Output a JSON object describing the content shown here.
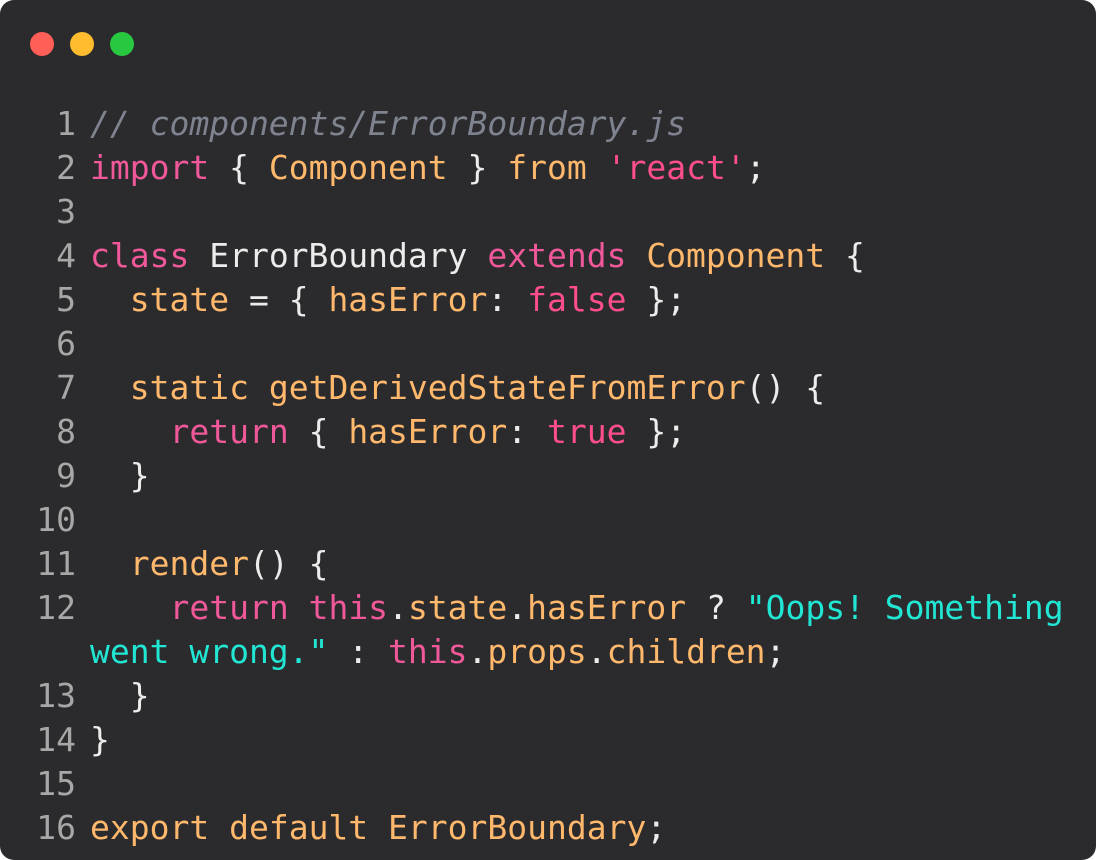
{
  "window": {
    "controls": [
      {
        "name": "close",
        "color": "#ff5f57"
      },
      {
        "name": "minimize",
        "color": "#febc2e"
      },
      {
        "name": "zoom",
        "color": "#28c840"
      }
    ]
  },
  "colors": {
    "background": "#2b2b2d",
    "keyword": "#f0589a",
    "identifier": "#ffb86c",
    "string": "#22e6d4",
    "comment": "#7f8390",
    "line_number": "#a7a7a7"
  },
  "code": {
    "lines": [
      {
        "n": "1",
        "tokens": [
          {
            "t": "// components/ErrorBoundary.js",
            "c": "comment"
          }
        ]
      },
      {
        "n": "2",
        "tokens": [
          {
            "t": "import",
            "c": "key"
          },
          {
            "t": " { ",
            "c": "plain"
          },
          {
            "t": "Component",
            "c": "orange"
          },
          {
            "t": " } ",
            "c": "plain"
          },
          {
            "t": "from",
            "c": "orange"
          },
          {
            "t": " ",
            "c": "plain"
          },
          {
            "t": "'react'",
            "c": "string"
          },
          {
            "t": ";",
            "c": "plain"
          }
        ]
      },
      {
        "n": "3",
        "tokens": []
      },
      {
        "n": "4",
        "tokens": [
          {
            "t": "class",
            "c": "key"
          },
          {
            "t": " ErrorBoundary ",
            "c": "plain"
          },
          {
            "t": "extends",
            "c": "key"
          },
          {
            "t": " ",
            "c": "plain"
          },
          {
            "t": "Component",
            "c": "orange"
          },
          {
            "t": " {",
            "c": "plain"
          }
        ]
      },
      {
        "n": "5",
        "tokens": [
          {
            "t": "  ",
            "c": "plain"
          },
          {
            "t": "state",
            "c": "orange"
          },
          {
            "t": " = { ",
            "c": "plain"
          },
          {
            "t": "hasError",
            "c": "orange"
          },
          {
            "t": ": ",
            "c": "plain"
          },
          {
            "t": "false",
            "c": "bool"
          },
          {
            "t": " };",
            "c": "plain"
          }
        ]
      },
      {
        "n": "6",
        "tokens": []
      },
      {
        "n": "7",
        "tokens": [
          {
            "t": "  ",
            "c": "plain"
          },
          {
            "t": "static",
            "c": "orange"
          },
          {
            "t": " ",
            "c": "plain"
          },
          {
            "t": "getDerivedStateFromError",
            "c": "orange"
          },
          {
            "t": "() {",
            "c": "plain"
          }
        ]
      },
      {
        "n": "8",
        "tokens": [
          {
            "t": "    ",
            "c": "plain"
          },
          {
            "t": "return",
            "c": "key"
          },
          {
            "t": " { ",
            "c": "plain"
          },
          {
            "t": "hasError",
            "c": "orange"
          },
          {
            "t": ": ",
            "c": "plain"
          },
          {
            "t": "true",
            "c": "bool"
          },
          {
            "t": " };",
            "c": "plain"
          }
        ]
      },
      {
        "n": "9",
        "tokens": [
          {
            "t": "  }",
            "c": "plain"
          }
        ]
      },
      {
        "n": "10",
        "tokens": []
      },
      {
        "n": "11",
        "tokens": [
          {
            "t": "  ",
            "c": "plain"
          },
          {
            "t": "render",
            "c": "orange"
          },
          {
            "t": "() {",
            "c": "plain"
          }
        ]
      },
      {
        "n": "12",
        "tokens": [
          {
            "t": "    ",
            "c": "plain"
          },
          {
            "t": "return",
            "c": "key"
          },
          {
            "t": " ",
            "c": "plain"
          },
          {
            "t": "this",
            "c": "key"
          },
          {
            "t": ".",
            "c": "plain"
          },
          {
            "t": "state",
            "c": "orange"
          },
          {
            "t": ".",
            "c": "plain"
          },
          {
            "t": "hasError",
            "c": "orange"
          },
          {
            "t": " ? ",
            "c": "plain"
          },
          {
            "t": "\"Oops! Something",
            "c": "cyan"
          }
        ]
      },
      {
        "n": "",
        "tokens": [
          {
            "t": "went wrong.\"",
            "c": "cyan"
          },
          {
            "t": " : ",
            "c": "plain"
          },
          {
            "t": "this",
            "c": "key"
          },
          {
            "t": ".",
            "c": "plain"
          },
          {
            "t": "props",
            "c": "orange"
          },
          {
            "t": ".",
            "c": "plain"
          },
          {
            "t": "children",
            "c": "orange"
          },
          {
            "t": ";",
            "c": "plain"
          }
        ]
      },
      {
        "n": "13",
        "tokens": [
          {
            "t": "  }",
            "c": "plain"
          }
        ]
      },
      {
        "n": "14",
        "tokens": [
          {
            "t": "}",
            "c": "plain"
          }
        ]
      },
      {
        "n": "15",
        "tokens": []
      },
      {
        "n": "16",
        "tokens": [
          {
            "t": "export",
            "c": "orange"
          },
          {
            "t": " ",
            "c": "plain"
          },
          {
            "t": "default",
            "c": "orange"
          },
          {
            "t": " ",
            "c": "plain"
          },
          {
            "t": "ErrorBoundary",
            "c": "orange"
          },
          {
            "t": ";",
            "c": "plain"
          }
        ]
      }
    ]
  }
}
